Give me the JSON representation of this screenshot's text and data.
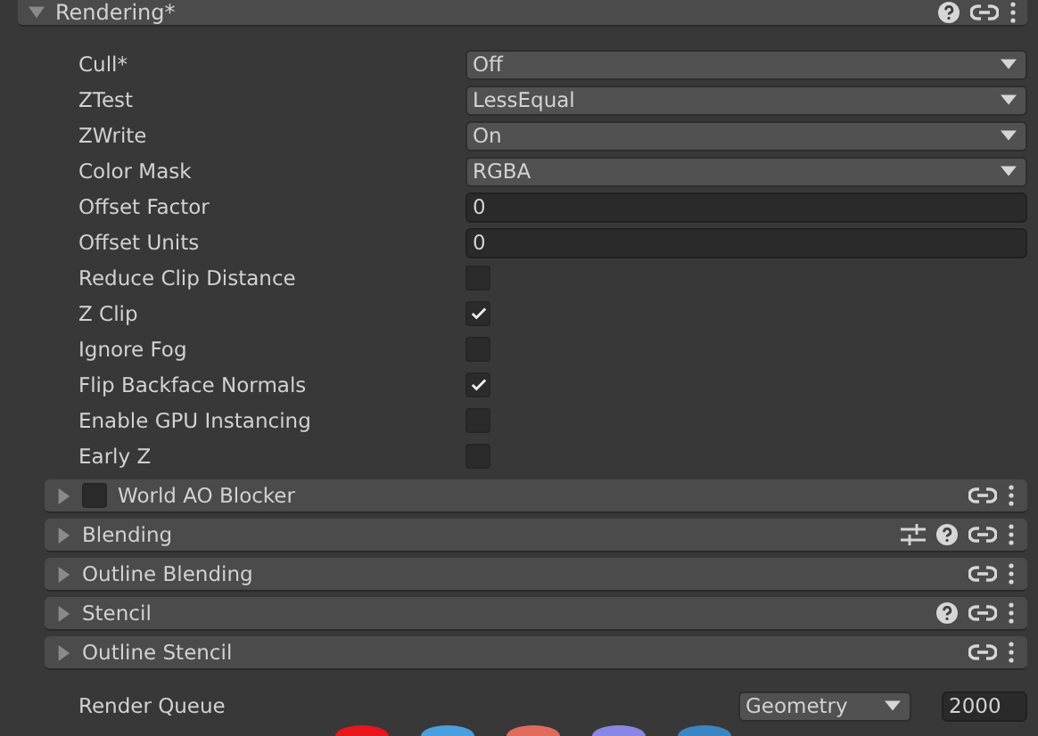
{
  "header": {
    "title": "Rendering*",
    "expanded": true,
    "help_button": true,
    "link_button": true,
    "menu_button": true
  },
  "properties": [
    {
      "kind": "dropdown",
      "label": "Cull*",
      "value": "Off"
    },
    {
      "kind": "dropdown",
      "label": "ZTest",
      "value": "LessEqual"
    },
    {
      "kind": "dropdown",
      "label": "ZWrite",
      "value": "On"
    },
    {
      "kind": "dropdown",
      "label": "Color Mask",
      "value": "RGBA"
    },
    {
      "kind": "number",
      "label": "Offset Factor",
      "value": "0"
    },
    {
      "kind": "number",
      "label": "Offset Units",
      "value": "0"
    },
    {
      "kind": "checkbox",
      "label": "Reduce Clip Distance",
      "checked": false
    },
    {
      "kind": "checkbox",
      "label": "Z Clip",
      "checked": true
    },
    {
      "kind": "checkbox",
      "label": "Ignore Fog",
      "checked": false
    },
    {
      "kind": "checkbox",
      "label": "Flip Backface Normals",
      "checked": true
    },
    {
      "kind": "checkbox",
      "label": "Enable GPU Instancing",
      "checked": false
    },
    {
      "kind": "checkbox",
      "label": "Early Z",
      "checked": false
    }
  ],
  "sections": [
    {
      "title": "World AO Blocker",
      "expanded": false,
      "toggle": {
        "checked": false
      },
      "presets_button": false,
      "help_button": false,
      "link_button": true,
      "menu_button": true
    },
    {
      "title": "Blending",
      "expanded": false,
      "presets_button": true,
      "help_button": true,
      "link_button": true,
      "menu_button": true
    },
    {
      "title": "Outline Blending",
      "expanded": false,
      "presets_button": false,
      "help_button": false,
      "link_button": true,
      "menu_button": true
    },
    {
      "title": "Stencil",
      "expanded": false,
      "presets_button": false,
      "help_button": true,
      "link_button": true,
      "menu_button": true
    },
    {
      "title": "Outline Stencil",
      "expanded": false,
      "presets_button": false,
      "help_button": false,
      "link_button": true,
      "menu_button": true
    }
  ],
  "render_queue": {
    "label": "Render Queue",
    "preset": "Geometry",
    "value": "2000"
  },
  "swatches": [
    {
      "color": "#e8151b"
    },
    {
      "color": "#4a9fe0"
    },
    {
      "color": "#e06a5c"
    },
    {
      "color": "#8a86e6"
    },
    {
      "color": "#3a86c4"
    }
  ]
}
